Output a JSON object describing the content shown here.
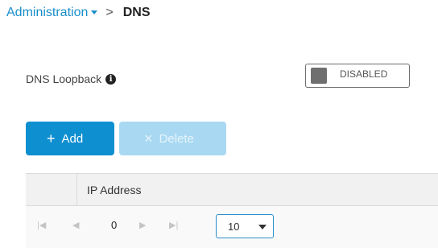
{
  "breadcrumb": {
    "parent": "Administration",
    "separator": ">",
    "current": "DNS"
  },
  "loopback": {
    "label": "DNS Loopback",
    "state": "DISABLED"
  },
  "toolbar": {
    "add_label": "Add",
    "delete_label": "Delete"
  },
  "table": {
    "columns": [
      "IP Address"
    ]
  },
  "pagination": {
    "current_page": "0",
    "page_size": "10"
  },
  "colors": {
    "accent": "#0e8fd0",
    "accent_disabled": "#a9d9f2",
    "toggle_off": "#6f6f6f"
  }
}
